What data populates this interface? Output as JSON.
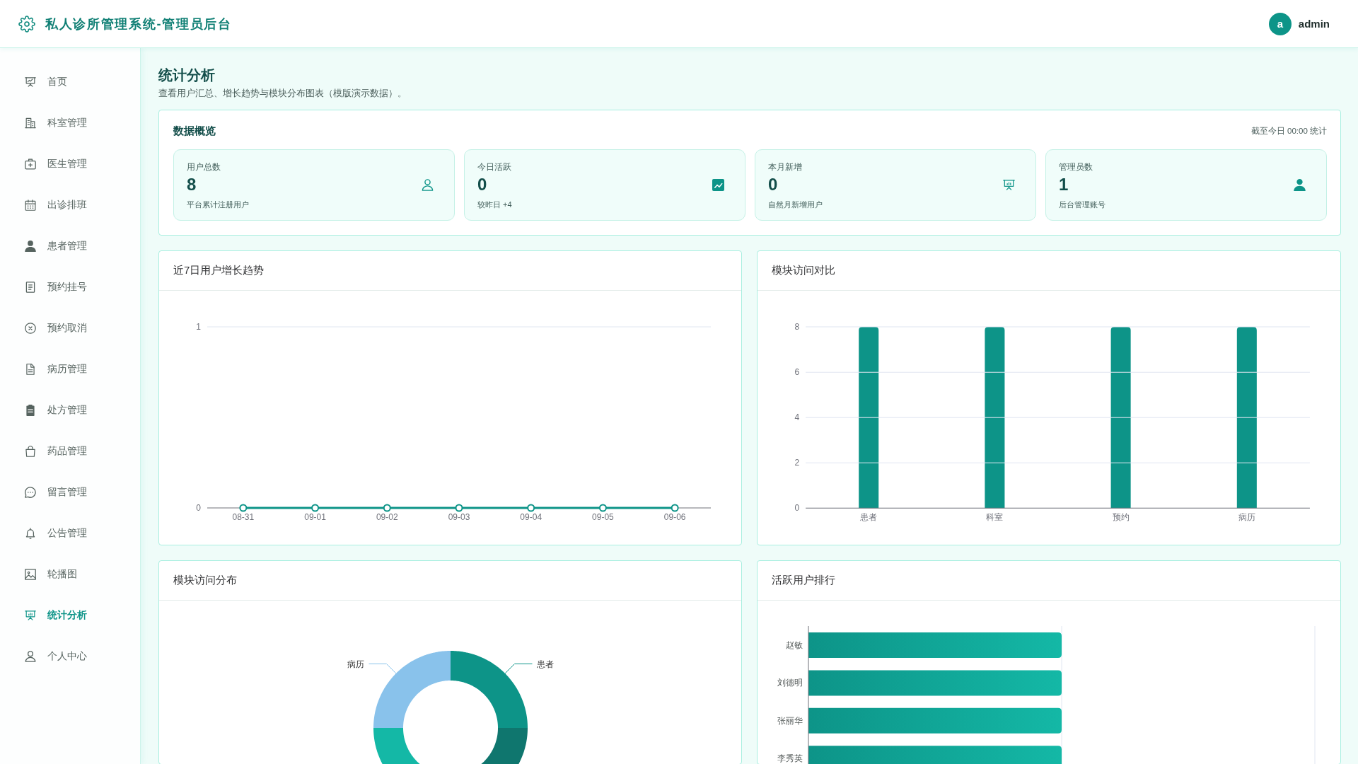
{
  "header": {
    "title": "私人诊所管理系统-管理员后台",
    "user": {
      "avatar_letter": "a",
      "name": "admin"
    }
  },
  "sidebar": {
    "items": [
      {
        "label": "首页",
        "selected": false
      },
      {
        "label": "科室管理",
        "selected": false
      },
      {
        "label": "医生管理",
        "selected": false
      },
      {
        "label": "出诊排班",
        "selected": false
      },
      {
        "label": "患者管理",
        "selected": false
      },
      {
        "label": "预约挂号",
        "selected": false
      },
      {
        "label": "预约取消",
        "selected": false
      },
      {
        "label": "病历管理",
        "selected": false
      },
      {
        "label": "处方管理",
        "selected": false
      },
      {
        "label": "药品管理",
        "selected": false
      },
      {
        "label": "留言管理",
        "selected": false
      },
      {
        "label": "公告管理",
        "selected": false
      },
      {
        "label": "轮播图",
        "selected": false
      },
      {
        "label": "统计分析",
        "selected": true
      },
      {
        "label": "个人中心",
        "selected": false
      }
    ]
  },
  "page": {
    "title": "统计分析",
    "subtitle": "查看用户汇总、增长趋势与模块分布图表（模版演示数据）。"
  },
  "overview": {
    "title": "数据概览",
    "note": "截至今日 00:00 统计",
    "stats": [
      {
        "label": "用户总数",
        "value": "8",
        "note": "平台累计注册用户"
      },
      {
        "label": "今日活跃",
        "value": "0",
        "note": "较昨日 +4"
      },
      {
        "label": "本月新增",
        "value": "0",
        "note": "自然月新增用户"
      },
      {
        "label": "管理员数",
        "value": "1",
        "note": "后台管理账号"
      }
    ]
  },
  "growth_chart": {
    "title": "近7日用户增长趋势",
    "chart_data": {
      "type": "line",
      "categories": [
        "08-31",
        "09-01",
        "09-02",
        "09-03",
        "09-04",
        "09-05",
        "09-06"
      ],
      "series": [
        {
          "color": "#0d9488",
          "marker": "circle",
          "values": [
            0,
            0,
            0,
            0,
            0,
            0,
            0
          ]
        }
      ],
      "ylim": [
        0,
        1
      ],
      "yticks": [
        0,
        1
      ],
      "grid": true
    }
  },
  "module_chart": {
    "title": "模块访问对比",
    "chart_data": {
      "type": "bar",
      "categories": [
        "患者",
        "科室",
        "预约",
        "病历"
      ],
      "series": [
        {
          "color": "#0d9488",
          "values": [
            8,
            8,
            8,
            8
          ]
        }
      ],
      "ylim": [
        0,
        8
      ],
      "yticks": [
        0,
        2,
        4,
        6,
        8
      ],
      "grid": true
    }
  },
  "distribution_chart": {
    "title": "模块访问分布",
    "slices": [
      {
        "label": "病历",
        "color": "#89c2eb"
      },
      {
        "label": "患者",
        "color": "#0d9488"
      },
      {
        "color": "#0f766e"
      },
      {
        "color": "#14b8a6"
      }
    ]
  },
  "ranking_chart": {
    "title": "活跃用户排行",
    "rows": [
      {
        "name": "赵敏"
      },
      {
        "name": "刘德明"
      },
      {
        "name": "张丽华"
      },
      {
        "name": "李秀英"
      }
    ]
  }
}
